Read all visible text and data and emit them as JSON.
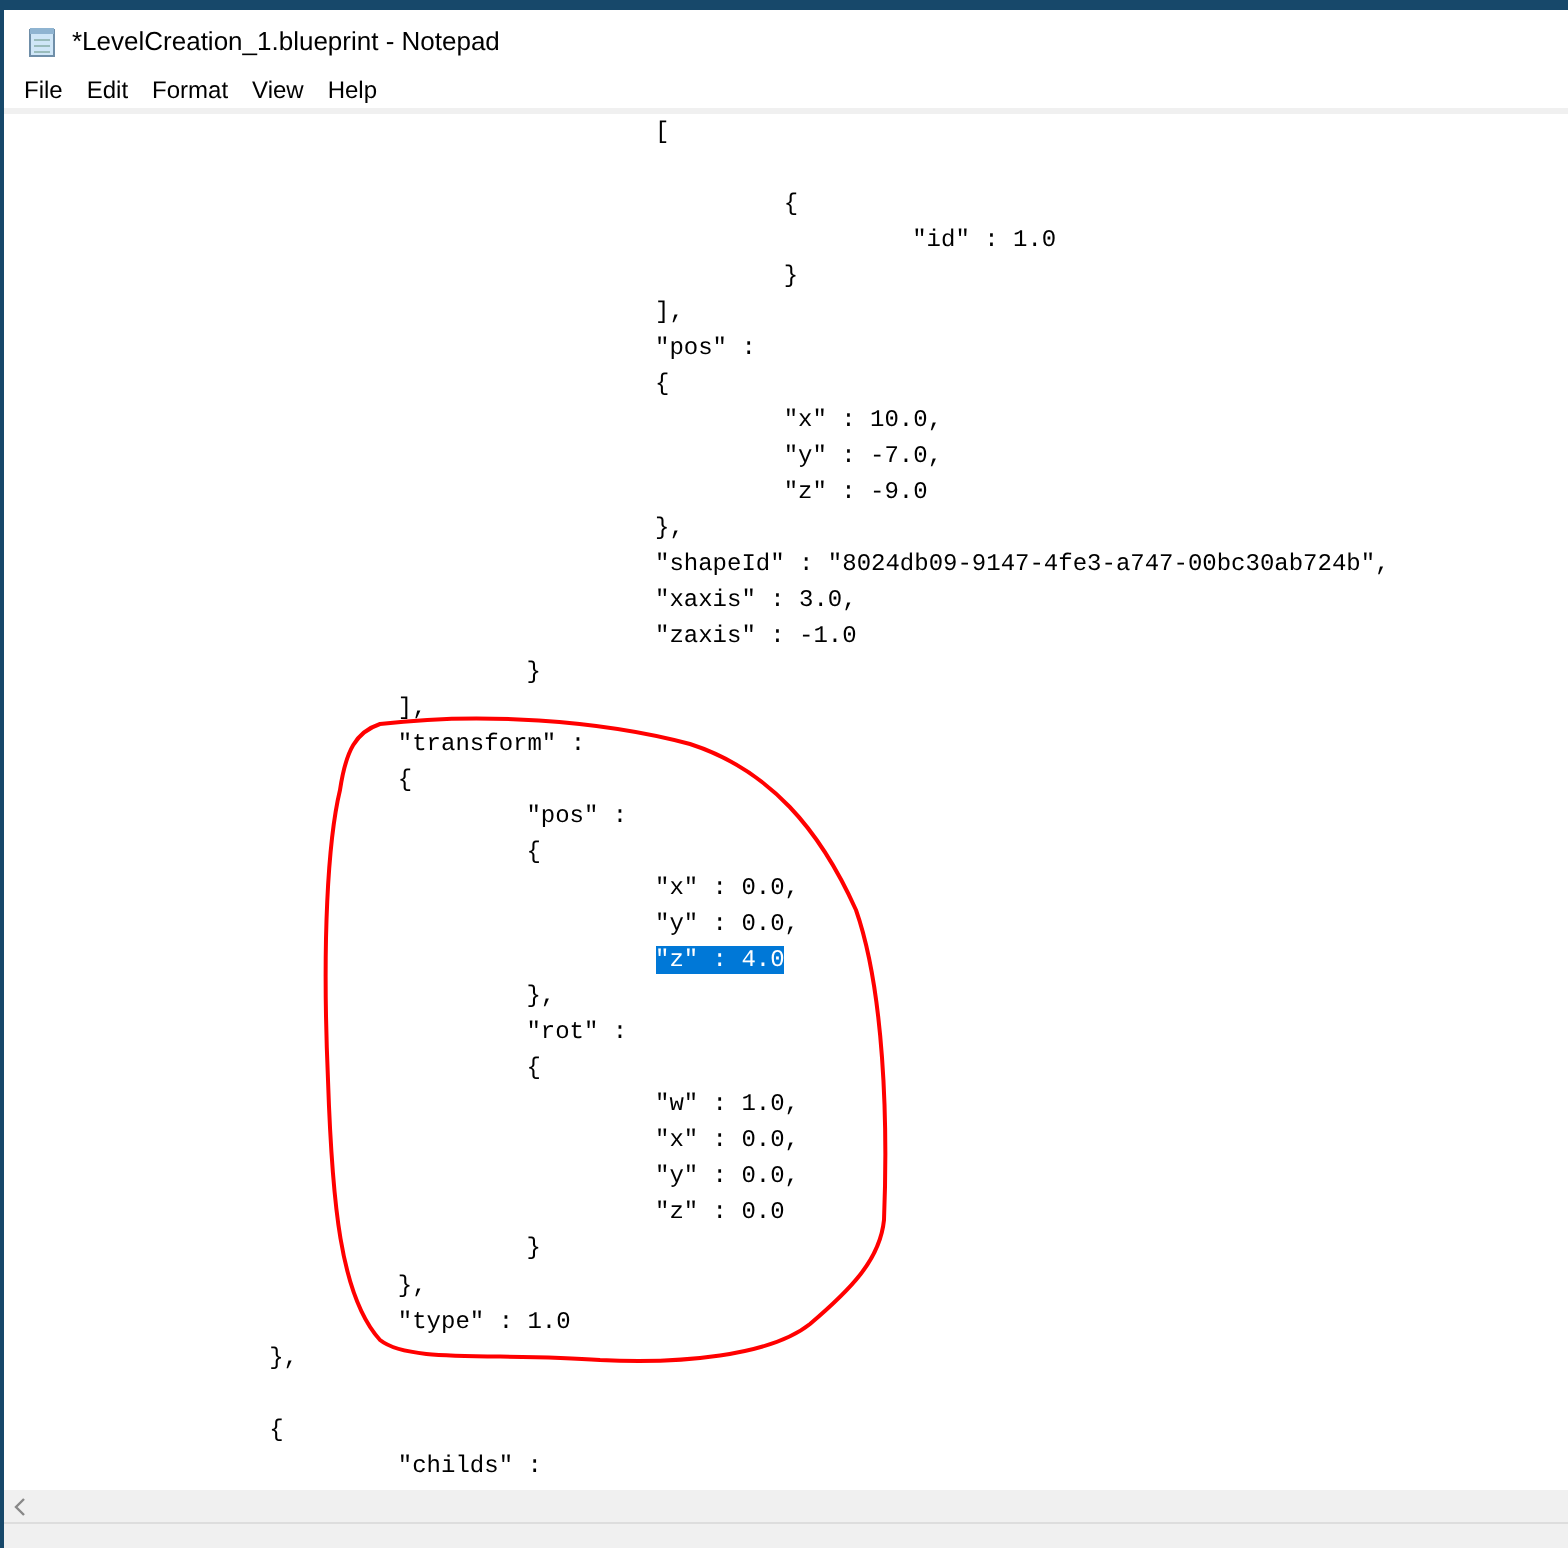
{
  "window": {
    "title": "*LevelCreation_1.blueprint - Notepad"
  },
  "menu": [
    "File",
    "Edit",
    "Format",
    "View",
    "Help"
  ],
  "lines": [
    {
      "kind": "code",
      "text": "\t\t\t\t\t[",
      "selected": false
    },
    {
      "kind": "blank"
    },
    {
      "kind": "code",
      "text": "\t\t\t\t\t\t{",
      "selected": false
    },
    {
      "kind": "code",
      "text": "\t\t\t\t\t\t\t\"id\" : 1.0",
      "selected": false
    },
    {
      "kind": "code",
      "text": "\t\t\t\t\t\t}",
      "selected": false
    },
    {
      "kind": "code",
      "text": "\t\t\t\t\t],",
      "selected": false
    },
    {
      "kind": "code",
      "text": "\t\t\t\t\t\"pos\" :",
      "selected": false
    },
    {
      "kind": "code",
      "text": "\t\t\t\t\t{",
      "selected": false
    },
    {
      "kind": "code",
      "text": "\t\t\t\t\t\t\"x\" : 10.0,",
      "selected": false
    },
    {
      "kind": "code",
      "text": "\t\t\t\t\t\t\"y\" : -7.0,",
      "selected": false
    },
    {
      "kind": "code",
      "text": "\t\t\t\t\t\t\"z\" : -9.0",
      "selected": false
    },
    {
      "kind": "code",
      "text": "\t\t\t\t\t},",
      "selected": false
    },
    {
      "kind": "code",
      "text": "\t\t\t\t\t\"shapeId\" : \"8024db09-9147-4fe3-a747-00bc30ab724b\",",
      "selected": false
    },
    {
      "kind": "code",
      "text": "\t\t\t\t\t\"xaxis\" : 3.0,",
      "selected": false
    },
    {
      "kind": "code",
      "text": "\t\t\t\t\t\"zaxis\" : -1.0",
      "selected": false
    },
    {
      "kind": "code",
      "text": "\t\t\t\t}",
      "selected": false
    },
    {
      "kind": "code",
      "text": "\t\t\t],",
      "selected": false
    },
    {
      "kind": "code",
      "text": "\t\t\t\"transform\" :",
      "selected": false
    },
    {
      "kind": "code",
      "text": "\t\t\t{",
      "selected": false
    },
    {
      "kind": "code",
      "text": "\t\t\t\t\"pos\" :",
      "selected": false
    },
    {
      "kind": "code",
      "text": "\t\t\t\t{",
      "selected": false
    },
    {
      "kind": "code",
      "text": "\t\t\t\t\t\"x\" : 0.0,",
      "selected": false
    },
    {
      "kind": "code",
      "text": "\t\t\t\t\t\"y\" : 0.0,",
      "selected": false
    },
    {
      "kind": "code",
      "text": "\t\t\t\t\t\"z\" : 4.0",
      "selected": true
    },
    {
      "kind": "code",
      "text": "\t\t\t\t},",
      "selected": false
    },
    {
      "kind": "code",
      "text": "\t\t\t\t\"rot\" :",
      "selected": false
    },
    {
      "kind": "code",
      "text": "\t\t\t\t{",
      "selected": false
    },
    {
      "kind": "code",
      "text": "\t\t\t\t\t\"w\" : 1.0,",
      "selected": false
    },
    {
      "kind": "code",
      "text": "\t\t\t\t\t\"x\" : 0.0,",
      "selected": false
    },
    {
      "kind": "code",
      "text": "\t\t\t\t\t\"y\" : 0.0,",
      "selected": false
    },
    {
      "kind": "code",
      "text": "\t\t\t\t\t\"z\" : 0.0",
      "selected": false
    },
    {
      "kind": "code",
      "text": "\t\t\t\t}",
      "selected": false
    },
    {
      "kind": "code",
      "text": "\t\t\t},",
      "selected": false
    },
    {
      "kind": "code",
      "text": "\t\t\t\"type\" : 1.0",
      "selected": false
    },
    {
      "kind": "code",
      "text": "\t\t},",
      "selected": false
    },
    {
      "kind": "blank"
    },
    {
      "kind": "code",
      "text": "\t\t{",
      "selected": false
    },
    {
      "kind": "code",
      "text": "\t\t\t\"childs\" :",
      "selected": false
    }
  ],
  "annotation": {
    "kind": "circle",
    "color": "#ff0000"
  }
}
